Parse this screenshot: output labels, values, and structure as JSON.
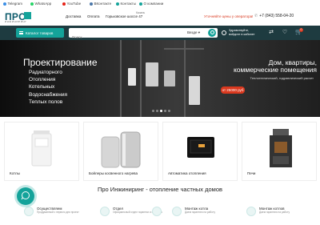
{
  "topbar": {
    "links": [
      {
        "label": "Telegram",
        "icon": "telegram-icon"
      },
      {
        "label": "WhatsApp",
        "icon": "whatsapp-icon"
      },
      {
        "label": "YouTube",
        "icon": "youtube-icon"
      },
      {
        "label": "ВКонтакте",
        "icon": "vk-icon"
      },
      {
        "label": "Контакты",
        "icon": "pin-icon"
      },
      {
        "label": "О компании",
        "icon": "info-icon"
      }
    ]
  },
  "header": {
    "logo": "ПРО",
    "logo_sub": "ИНЖИНИРИНГ",
    "nav": [
      "Доставка",
      "Оплата",
      "Горьковское шоссе 47"
    ],
    "city_small": "Казань",
    "promo": "Уточняйте цены у оператора!",
    "phone": "+7 (843) 558-04-20"
  },
  "toolbar": {
    "catalog": "Каталог товаров",
    "search_placeholder": "Поиск",
    "search_scope": "Везде",
    "account_line1": "Здравствуйте,",
    "account_line2": "войдите в кабинет",
    "cart_count": "0"
  },
  "hero": {
    "title": "Проектирование",
    "items": [
      "Радиаторного",
      "Отопления",
      "Котельных",
      "Водоснабжения",
      "Теплых полов"
    ],
    "right_title_1": "Дом, квартиры,",
    "right_title_2": "коммерческие помещения",
    "right_sub": "Теплотехнический, гидравлический расчет",
    "price": "от 25000 руб"
  },
  "cards": [
    {
      "label": "Котлы"
    },
    {
      "label": "Бойлеры косвенного нагрева"
    },
    {
      "label": "Автоматика отопления"
    },
    {
      "label": "Печи"
    }
  ],
  "section_title": "Про Инжиниринг - отопление частных домов",
  "features": [
    {
      "title": "Осуществляем",
      "desc": "Продуманный с первого дня проект"
    },
    {
      "title": "Отдел",
      "desc": "Официальный отдел гарантии и качества"
    },
    {
      "title": "",
      "desc": ""
    },
    {
      "title": "Монтаж котла",
      "desc": "Даем гарантию на работу"
    },
    {
      "title": "Монтаж котлов",
      "desc": "Даем гарантию на работу"
    }
  ],
  "colors": {
    "accent": "#14a39a",
    "dark_bar": "#1e3b40",
    "promo": "#d9381e"
  }
}
